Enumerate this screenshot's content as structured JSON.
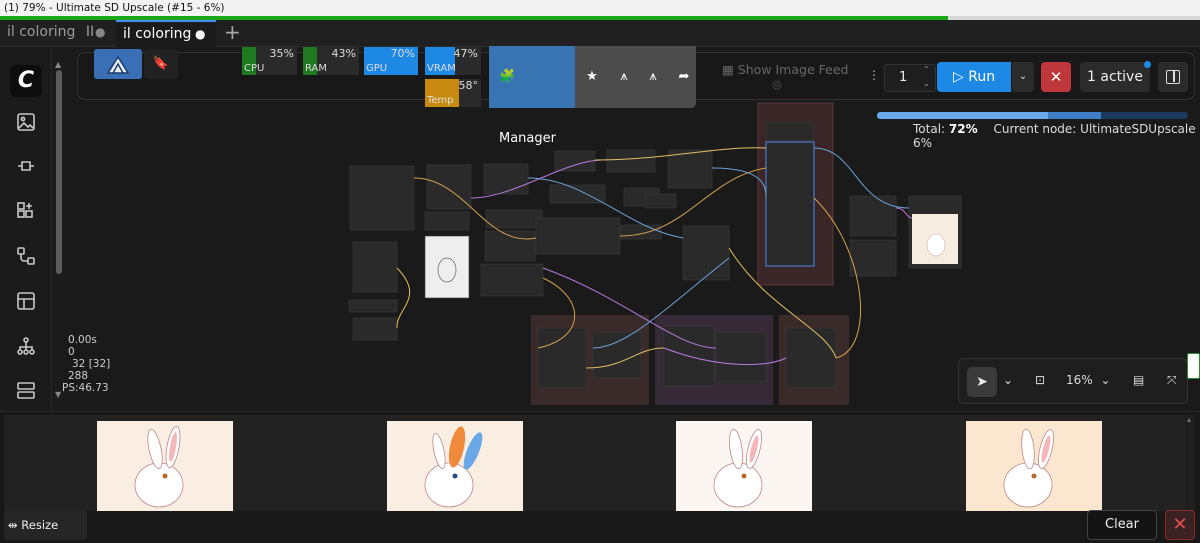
{
  "window": {
    "title": "(1) 79% - Ultimate SD Upscale (#15 - 6%)",
    "progress_percent": 79
  },
  "tabs": [
    {
      "label": "il coloring",
      "suffix": "II",
      "modified": true,
      "active": false
    },
    {
      "label": "il coloring",
      "modified": true,
      "active": true
    }
  ],
  "tab_dot": "●",
  "new_tab_icon": "+",
  "logo_text": "C",
  "sidebar_icons": [
    "comfy-logo-icon",
    "image-icon",
    "model-library-icon",
    "node-library-icon",
    "workflows-icon",
    "templates-icon",
    "queue-tree-icon",
    "layout-icon"
  ],
  "monitors": [
    {
      "label": "CPU",
      "value": "35%",
      "color": "#1f7a1f",
      "level": 35
    },
    {
      "label": "RAM",
      "value": "43%",
      "color": "#1f7a1f",
      "level": 43
    },
    {
      "label": "GPU",
      "value": "70%",
      "color": "#1e88e5",
      "level": 70
    },
    {
      "label": "VRAM",
      "value": "47%",
      "color": "#1e88e5",
      "level": 47
    },
    {
      "label": "Temp",
      "value": "58°",
      "color": "#c88a10",
      "level": 58
    }
  ],
  "manager": {
    "label": "Manager",
    "icons": [
      "star-icon",
      "workflow-share-icon",
      "model-share-icon",
      "share-icon"
    ]
  },
  "show_image_feed": "Show Image Feed",
  "run": {
    "batch_count": "1",
    "run_label": "Run",
    "active_label": "1 active",
    "interrupt_icon": "✕"
  },
  "status": {
    "total_label": "Total:",
    "total_value": "72%",
    "current_node_label": "Current node: UltimateSDUpscale 6%",
    "total_progress": 72,
    "node_progress": 55
  },
  "stats": [
    "0.00s",
    "0",
    "32 [32]",
    "288",
    "PS:46.73"
  ],
  "canvas_controls": {
    "zoom": "16%"
  },
  "feed": {
    "resize_label": "Resize Feed",
    "clear_label": "Clear",
    "close_icon": "✕",
    "images": [
      "bunny-image-1",
      "bunny-image-2",
      "bunny-image-3",
      "bunny-image-4"
    ]
  },
  "colors": {
    "accent": "#1e88e5",
    "interrupt": "#c0373b",
    "manager": "#3873b2"
  }
}
